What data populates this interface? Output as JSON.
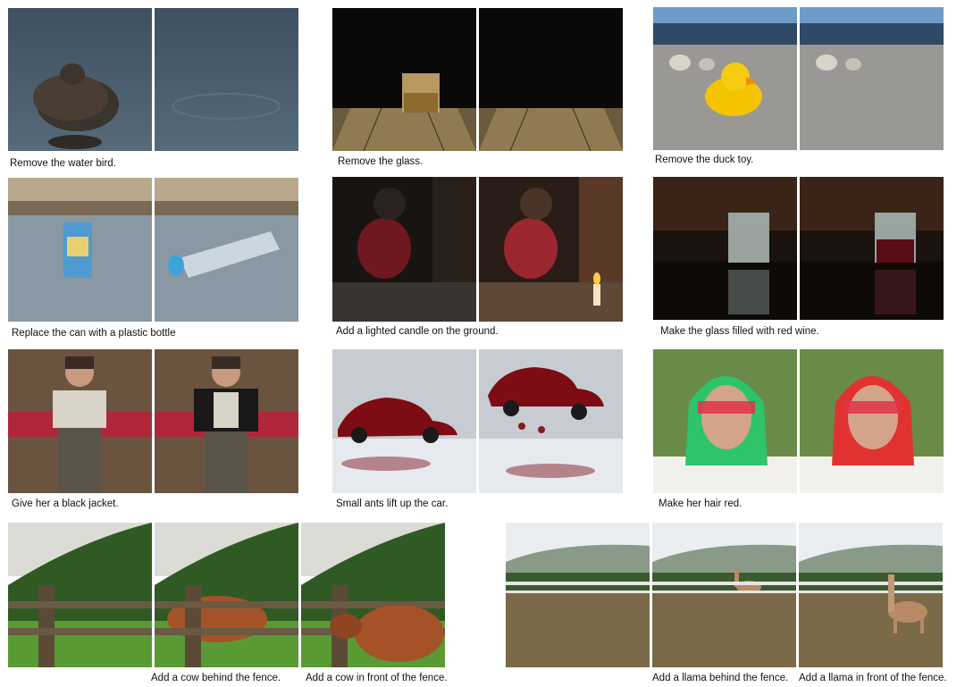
{
  "captions": {
    "bird": "Remove the water bird.",
    "glass": "Remove the glass.",
    "duck": "Remove the duck toy.",
    "can": "Replace the can with a plastic bottle",
    "candle": "Add a lighted candle on the ground.",
    "wine": "Make the glass filled with red wine.",
    "jacket": "Give her a black jacket.",
    "ants": "Small ants lift up the car.",
    "hair": "Make her hair red.",
    "cow_behind": "Add a cow behind the fence.",
    "cow_front": "Add a cow in front of the fence.",
    "llama_behind": "Add a llama behind the fence.",
    "llama_front": "Add a llama in front of the fence."
  },
  "colors": {
    "water": "#4b5e6e",
    "dark": "#0d0a08",
    "sand": "#9c9a96",
    "duck": "#f5c400",
    "ice": "#8c9aa6",
    "hoodie": "#8d1f2a",
    "car": "#7d0c14",
    "hair_green": "#2dc46a",
    "hair_red": "#e0332f",
    "grass": "#4c8a2e",
    "cow": "#a55228",
    "llama": "#b98a66"
  }
}
